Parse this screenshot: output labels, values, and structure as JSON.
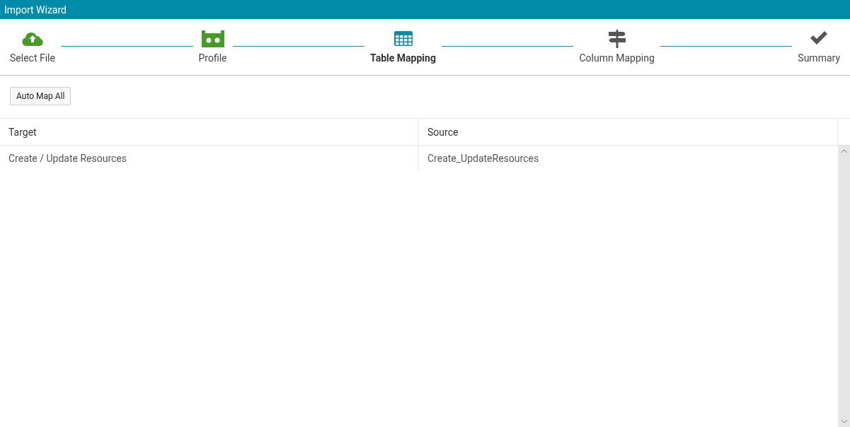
{
  "window": {
    "title": "Import Wizard"
  },
  "steps": [
    {
      "label": "Select File",
      "kind": "upload",
      "completed": true,
      "selected": false
    },
    {
      "label": "Profile",
      "kind": "profile",
      "completed": true,
      "selected": false
    },
    {
      "label": "Table Mapping",
      "kind": "table",
      "completed": false,
      "selected": true
    },
    {
      "label": "Column Mapping",
      "kind": "columns",
      "completed": false,
      "selected": false
    },
    {
      "label": "Summary",
      "kind": "summary",
      "completed": false,
      "selected": false
    }
  ],
  "toolbar": {
    "buttons": [
      "Auto Map All"
    ]
  },
  "table": {
    "columns": [
      "Target",
      "Source"
    ],
    "rows": [
      [
        "Create / Update Resources",
        "Create_UpdateResources"
      ]
    ]
  }
}
